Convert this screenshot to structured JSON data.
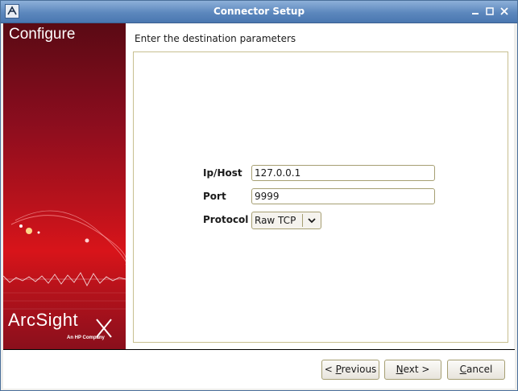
{
  "window": {
    "title": "Connector Setup"
  },
  "sidebar": {
    "title": "Configure",
    "brand": "ArcSight",
    "brand_sub": "An HP Company"
  },
  "main": {
    "heading": "Enter the destination parameters",
    "fields": {
      "host": {
        "label": "Ip/Host",
        "value": "127.0.0.1"
      },
      "port": {
        "label": "Port",
        "value": "9999"
      },
      "protocol": {
        "label": "Protocol",
        "value": "Raw TCP"
      }
    }
  },
  "buttons": {
    "previous": {
      "prefix": "< ",
      "mnemonic": "P",
      "rest": "revious"
    },
    "next": {
      "mnemonic": "N",
      "rest": "ext >"
    },
    "cancel": {
      "mnemonic": "C",
      "rest": "ancel"
    }
  },
  "colors": {
    "titlebar": "#5c87bd",
    "sidebar": "#b8121c",
    "border": "#a69f73"
  }
}
